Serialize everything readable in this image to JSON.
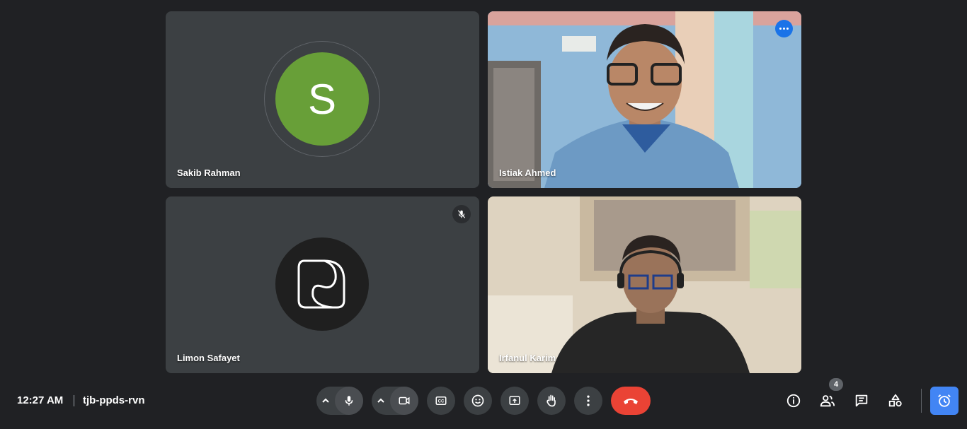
{
  "participants": [
    {
      "name": "Sakib Rahman",
      "avatar_letter": "S",
      "avatar_color": "#689f38"
    },
    {
      "name": "Istiak Ahmed",
      "active_speaker": true
    },
    {
      "name": "Limon Safayet",
      "muted": true
    },
    {
      "name": "Irfanul Karim"
    }
  ],
  "meeting": {
    "time": "12:27 AM",
    "code": "tjb-ppds-rvn"
  },
  "controls": {
    "icons": [
      "chevron-up-icon",
      "mic-icon",
      "camera-icon",
      "captions-icon",
      "emoji-icon",
      "present-icon",
      "hand-icon",
      "more-icon",
      "end-call-icon"
    ]
  },
  "side": {
    "people_count": "4",
    "icons": [
      "info-icon",
      "people-icon",
      "chat-icon",
      "activities-icon",
      "timer-icon"
    ]
  },
  "colors": {
    "background": "#202124",
    "tile": "#3c4043",
    "end_call": "#ea4335",
    "accent": "#4285f4"
  }
}
